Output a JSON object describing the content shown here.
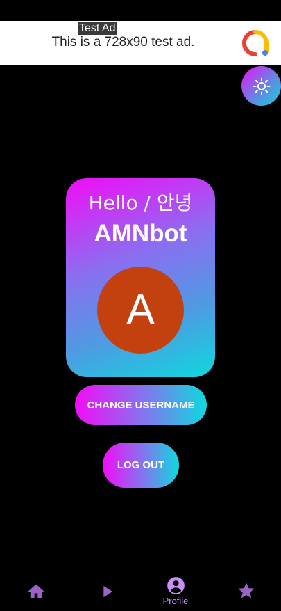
{
  "ad": {
    "tag": "Test Ad",
    "text": "This is a 728x90 test ad."
  },
  "theme_toggle": {
    "icon": "sun-icon"
  },
  "profile": {
    "greeting": "Hello / 안녕",
    "username": "AMNbot",
    "avatar_initial": "A"
  },
  "actions": {
    "change_username": "CHANGE USERNAME",
    "logout": "LOG OUT"
  },
  "nav": {
    "items": [
      {
        "icon": "home-icon",
        "label": ""
      },
      {
        "icon": "play-icon",
        "label": ""
      },
      {
        "icon": "account-circle-icon",
        "label": "Profile"
      },
      {
        "icon": "star-icon",
        "label": ""
      }
    ],
    "active_index": 2
  },
  "colors": {
    "accent_magenta": "#f20cf7",
    "accent_cyan": "#0fd8de",
    "avatar": "#c2410f",
    "nav_icon": "#9b63c9",
    "nav_active": "#c98ff7"
  }
}
